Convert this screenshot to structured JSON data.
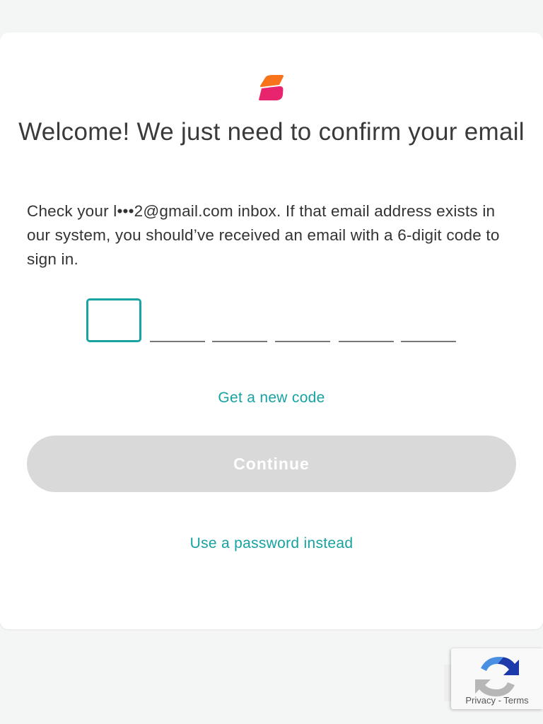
{
  "card": {
    "title": "Welcome! We just need to confirm your email",
    "description": "Check your l•••2@gmail.com inbox. If that email address exists in our system, you should’ve received an email with a 6-digit code to sign in.",
    "code_digits": [
      "",
      "",
      "",
      "",
      "",
      ""
    ],
    "get_new_code": "Get a new code",
    "continue_label": "Continue",
    "use_password": "Use a password instead"
  },
  "recaptcha": {
    "privacy": "Privacy",
    "separator": " - ",
    "terms": "Terms"
  },
  "colors": {
    "accent": "#17a2a2",
    "logo_orange": "#f7731c",
    "logo_pink": "#e8246e",
    "button_disabled": "#d9d9d9"
  },
  "icons": {
    "logo": "brand-logo-icon",
    "recaptcha": "recaptcha-icon"
  }
}
